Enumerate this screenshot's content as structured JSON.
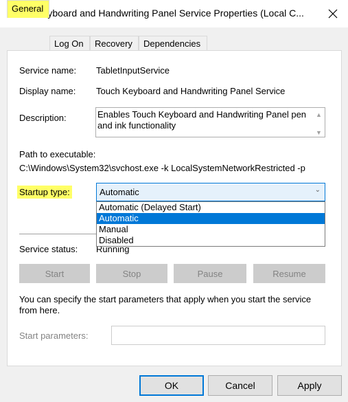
{
  "window": {
    "title": "Touch Keyboard and Handwriting Panel Service Properties (Local C...",
    "close_icon": "close-icon"
  },
  "tabs": [
    {
      "label": "General",
      "active": true
    },
    {
      "label": "Log On",
      "active": false
    },
    {
      "label": "Recovery",
      "active": false
    },
    {
      "label": "Dependencies",
      "active": false
    }
  ],
  "general": {
    "service_name_label": "Service name:",
    "service_name_value": "TabletInputService",
    "display_name_label": "Display name:",
    "display_name_value": "Touch Keyboard and Handwriting Panel Service",
    "description_label": "Description:",
    "description_value": "Enables Touch Keyboard and Handwriting Panel pen and ink functionality",
    "path_label": "Path to executable:",
    "path_value": "C:\\Windows\\System32\\svchost.exe -k LocalSystemNetworkRestricted -p",
    "startup_type_label": "Startup type:",
    "startup_type_value": "Automatic",
    "startup_options": [
      "Automatic (Delayed Start)",
      "Automatic",
      "Manual",
      "Disabled"
    ],
    "startup_selected_index": 1,
    "service_status_label": "Service status:",
    "service_status_value": "Running",
    "buttons": {
      "start": "Start",
      "stop": "Stop",
      "pause": "Pause",
      "resume": "Resume"
    },
    "info_text": "You can specify the start parameters that apply when you start the service from here.",
    "start_params_label": "Start parameters:",
    "start_params_value": ""
  },
  "footer": {
    "ok": "OK",
    "cancel": "Cancel",
    "apply": "Apply"
  },
  "colors": {
    "highlight": "#ffff66",
    "accent": "#0078d7"
  }
}
